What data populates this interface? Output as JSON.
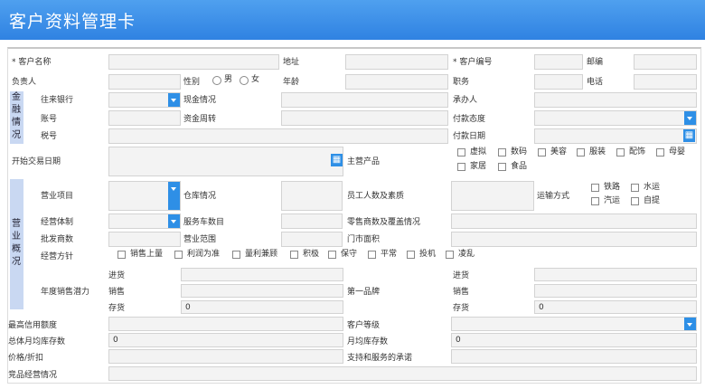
{
  "title": "客户资料管理卡",
  "labels": {
    "cust_name": "* 客户名称",
    "address": "地址",
    "cust_no": "* 客户编号",
    "postcode": "邮编",
    "owner": "负责人",
    "gender": "性别",
    "male": "男",
    "female": "女",
    "age": "年龄",
    "post": "职务",
    "phone": "电话",
    "bank": "往来银行",
    "cash": "现金情况",
    "handler": "承办人",
    "account": "账号",
    "fund_turnover": "资金周转",
    "pay_attitude": "付款态度",
    "tax_no": "税号",
    "pay_date": "付款日期",
    "start_date": "开始交易日期",
    "main_product": "主营产品",
    "biz_item": "营业项目",
    "warehouse": "仓库情况",
    "staff": "员工人数及素质",
    "transport": "运输方式",
    "biz_system": "经营体制",
    "vehicles": "服务车数目",
    "retailers": "零售商数及覆盖情况",
    "wholesalers": "批发商数",
    "biz_scope": "营业范围",
    "shop_area": "门市面积",
    "policy": "经营方针",
    "annual_potential": "年度销售潜力",
    "first_brand": "第一品牌",
    "purchase": "进货",
    "sales": "销售",
    "stock": "存货",
    "credit_limit": "最高信用额度",
    "cust_level": "客户等级",
    "total_monthly_stock": "总体月均库存数",
    "monthly_stock": "月均库存数",
    "price_discount": "价格/折扣",
    "support_commit": "支持和服务的承诺",
    "competitor": "竞品经营情况"
  },
  "finance_group": "金融情况",
  "biz_group": "营业概况",
  "products": [
    "虚拟",
    "数码",
    "美容",
    "服装",
    "配饰",
    "母婴",
    "家居",
    "食品"
  ],
  "transport_opts": [
    "铁路",
    "水运",
    "汽运",
    "自提"
  ],
  "policy_opts": [
    "销售上量",
    "利润为准",
    "量利兼顾",
    "积极",
    "保守",
    "平常",
    "投机",
    "凌乱"
  ],
  "values": {
    "stock_left": "0",
    "stock_right": "0",
    "total_monthly_stock": "0",
    "monthly_stock": "0"
  },
  "icons": {
    "calendar": "calendar-icon",
    "dropdown": "chevron-down-icon"
  },
  "colors": {
    "header": "#2f82e2",
    "accent": "#2e8fe6",
    "group_bg": "#c9d8f2"
  }
}
